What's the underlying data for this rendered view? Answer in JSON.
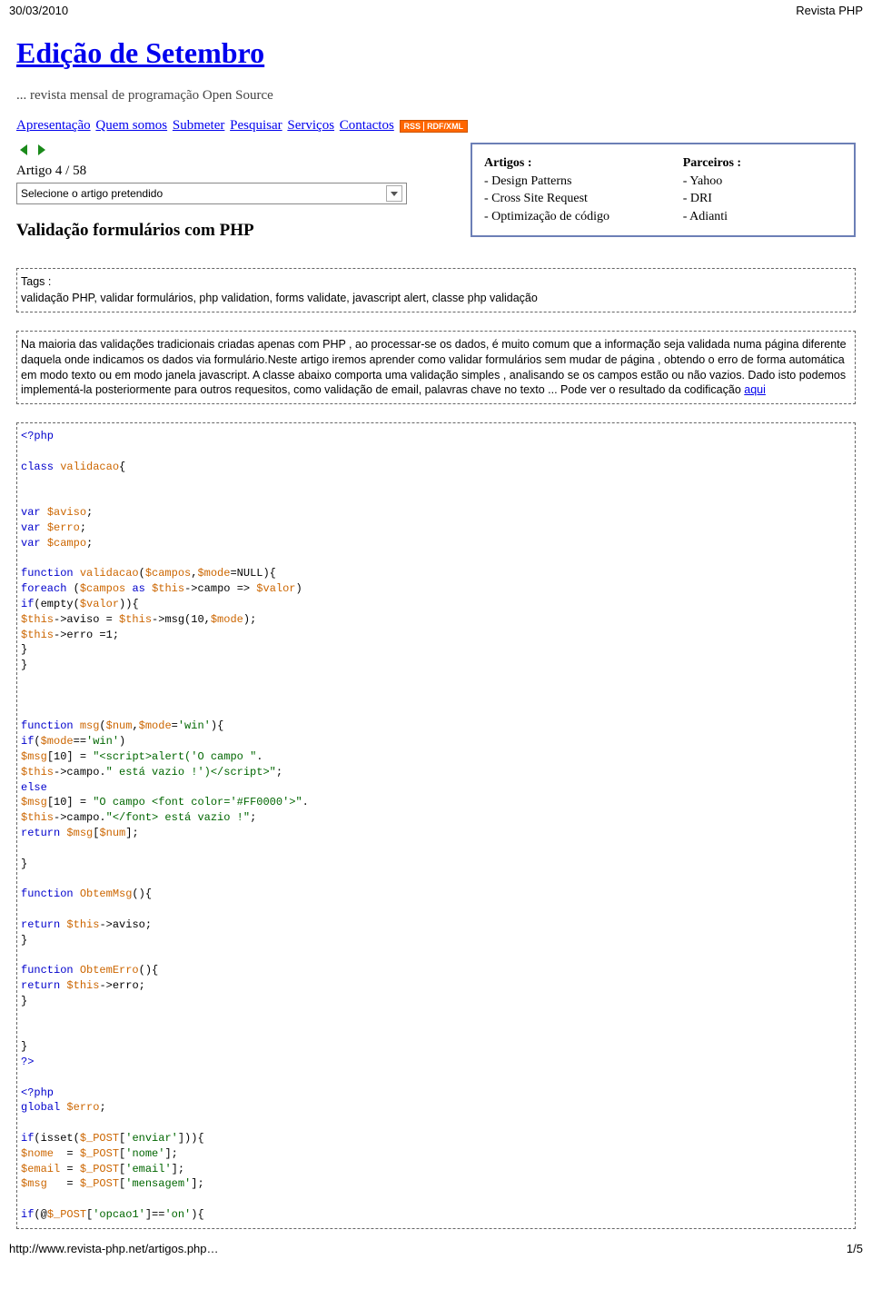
{
  "header": {
    "date": "30/03/2010",
    "site": "Revista PHP"
  },
  "main": {
    "title": "Edição de Setembro",
    "subtitle": "... revista mensal de programação Open Source",
    "nav": [
      "Apresentação",
      "Quem somos",
      "Submeter",
      "Pesquisar",
      "Serviços",
      "Contactos"
    ],
    "rss": [
      "RSS",
      "RDF/XML"
    ],
    "article_num": "Artigo 4 / 58",
    "select_placeholder": "Selecione o artigo pretendido",
    "section_title": "Validação formulários com PHP"
  },
  "sidebar": {
    "col1_title": "Artigos :",
    "col1_items": [
      "- Design Patterns",
      "- Cross Site Request",
      "- Optimização de código"
    ],
    "col2_title": "Parceiros :",
    "col2_items": [
      "- Yahoo",
      "- DRI",
      "- Adianti"
    ]
  },
  "tags": {
    "title": "Tags :",
    "text": "validação PHP, validar formulários, php validation, forms validate, javascript alert, classe php validação"
  },
  "body_text": "Na maioria das validações tradicionais criadas apenas com PHP , ao processar-se os dados, é muito comum que a informação seja validada numa página diferente daquela onde indicamos os dados via formulário.Neste artigo iremos aprender como validar formulários sem mudar de página , obtendo o erro de forma automática em modo texto ou em modo janela javascript. A classe abaixo comporta uma validação simples , analisando se os campos estão ou não vazios. Dado isto podemos implementá-la posteriormente para outros requesitos, como validação de email, palavras chave no texto ... Pode ver o resultado da codificação ",
  "body_link": "aqui",
  "footer": {
    "url": "http://www.revista-php.net/artigos.php…",
    "page": "1/5"
  }
}
